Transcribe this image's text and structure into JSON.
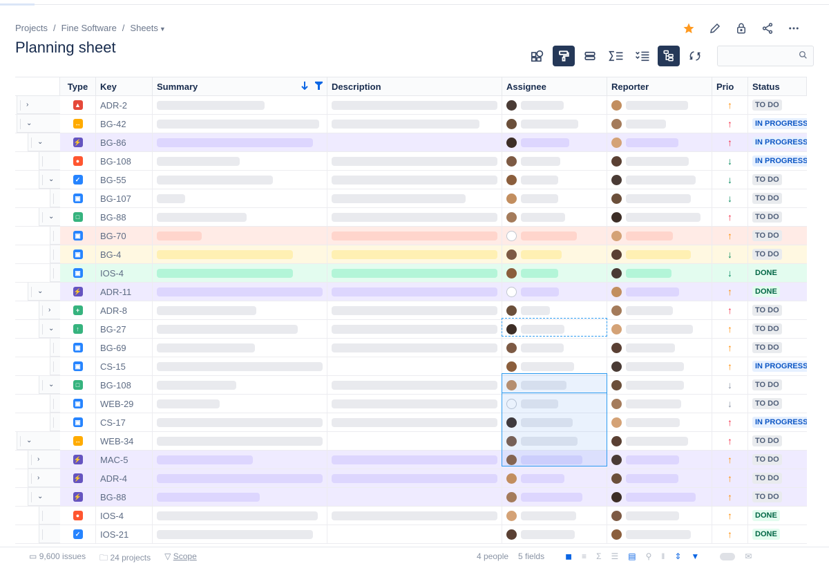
{
  "breadcrumb": [
    "Projects",
    "Fine Software",
    "Sheets"
  ],
  "page_title": "Planning sheet",
  "top_actions": [
    "star-icon",
    "edit-icon",
    "lock-icon",
    "share-icon",
    "more-icon"
  ],
  "toolbar": [
    {
      "icon": "dashboard-icon",
      "active": false
    },
    {
      "icon": "paint-roller-icon",
      "active": true
    },
    {
      "icon": "rows-icon",
      "active": false
    },
    {
      "icon": "sum-icon",
      "active": false
    },
    {
      "icon": "checklist-icon",
      "active": false
    },
    {
      "icon": "hierarchy-icon",
      "active": true
    },
    {
      "icon": "refresh-icon",
      "active": false
    }
  ],
  "search": {
    "placeholder": ""
  },
  "columns": [
    "",
    "Type",
    "Key",
    "Summary",
    "Description",
    "Assignee",
    "Reporter",
    "Prio",
    "Status"
  ],
  "colors": {
    "row_purple": "#efebff",
    "bar_purple": "#ddd6fe",
    "row_red": "#ffebe6",
    "bar_red": "#ffd5cc",
    "row_yellow": "#fff8e1",
    "bar_yellow": "#fff0b3",
    "row_green": "#e3fcef",
    "bar_green": "#b3f5d8",
    "prio_high": "#f42a45",
    "prio_medium": "#ff8b00",
    "prio_low": "#00875a",
    "prio_lowest": "#8993a4"
  },
  "rows": [
    {
      "level": 0,
      "toggle": "collapsed",
      "type": "bug",
      "key": "ADR-2",
      "summary": 0.65,
      "desc": 1.0,
      "assignee": "a1",
      "a_bar": 0.62,
      "reporter": "a2",
      "r_bar": 0.75,
      "prio": "medium",
      "status": "TO DO",
      "tint": ""
    },
    {
      "level": 0,
      "toggle": "expanded",
      "type": "epic-orange",
      "key": "BG-42",
      "summary": 0.98,
      "desc": 0.89,
      "assignee": "a3",
      "a_bar": 0.83,
      "reporter": "a4",
      "r_bar": 0.48,
      "prio": "high",
      "status": "IN PROGRESS",
      "tint": ""
    },
    {
      "level": 1,
      "toggle": "expanded",
      "type": "epic",
      "key": "BG-86",
      "summary": 0.94,
      "desc": 0,
      "assignee": "a5",
      "a_bar": 0.7,
      "reporter": "a6",
      "r_bar": 0.63,
      "prio": "high",
      "status": "IN PROGRESS",
      "tint": "purple"
    },
    {
      "level": 2,
      "toggle": "none",
      "type": "incident",
      "key": "BG-108",
      "summary": 0.5,
      "desc": 1.0,
      "assignee": "a7",
      "a_bar": 0.57,
      "reporter": "a8",
      "r_bar": 0.76,
      "prio": "low",
      "status": "IN PROGRESS",
      "tint": ""
    },
    {
      "level": 2,
      "toggle": "expanded",
      "type": "task",
      "key": "BG-55",
      "summary": 0.7,
      "desc": 1.0,
      "assignee": "a9",
      "a_bar": 0.54,
      "reporter": "a10",
      "r_bar": 0.84,
      "prio": "low",
      "status": "TO DO",
      "tint": ""
    },
    {
      "level": 3,
      "toggle": "none",
      "type": "subtask",
      "key": "BG-107",
      "summary": 0.17,
      "desc": 0.81,
      "assignee": "a11",
      "a_bar": 0.54,
      "reporter": "a12",
      "r_bar": 0.78,
      "prio": "low",
      "status": "TO DO",
      "tint": ""
    },
    {
      "level": 2,
      "toggle": "expanded",
      "type": "story",
      "key": "BG-88",
      "summary": 0.54,
      "desc": 1.0,
      "assignee": "a13",
      "a_bar": 0.64,
      "reporter": "a14",
      "r_bar": 0.9,
      "prio": "high",
      "status": "TO DO",
      "tint": ""
    },
    {
      "level": 3,
      "toggle": "none",
      "type": "subtask",
      "key": "BG-70",
      "summary": 0.27,
      "desc": 1.0,
      "assignee": "empty",
      "a_bar": 0.81,
      "reporter": "a15",
      "r_bar": 0.57,
      "prio": "medium",
      "status": "TO DO",
      "tint": "red"
    },
    {
      "level": 3,
      "toggle": "none",
      "type": "subtask",
      "key": "BG-4",
      "summary": 0.82,
      "desc": 1.0,
      "assignee": "a16",
      "a_bar": 0.59,
      "reporter": "a17",
      "r_bar": 0.78,
      "prio": "low",
      "status": "TO DO",
      "tint": "yellow"
    },
    {
      "level": 3,
      "toggle": "none",
      "type": "subtask",
      "key": "IOS-4",
      "summary": 0.82,
      "desc": 1.0,
      "assignee": "a18",
      "a_bar": 0.54,
      "reporter": "a19",
      "r_bar": 0.55,
      "prio": "low",
      "status": "DONE",
      "tint": "green"
    },
    {
      "level": 1,
      "toggle": "expanded",
      "type": "epic",
      "key": "ADR-11",
      "summary": 1.0,
      "desc": 1.0,
      "assignee": "empty",
      "a_bar": 0.55,
      "reporter": "a20",
      "r_bar": 0.64,
      "prio": "medium",
      "status": "DONE",
      "tint": "purple"
    },
    {
      "level": 2,
      "toggle": "collapsed",
      "type": "new-feature",
      "key": "ADR-8",
      "summary": 0.6,
      "desc": 1.0,
      "assignee": "a21",
      "a_bar": 0.42,
      "reporter": "a22",
      "r_bar": 0.57,
      "prio": "high",
      "status": "TO DO",
      "tint": ""
    },
    {
      "level": 2,
      "toggle": "expanded",
      "type": "improvement",
      "key": "BG-27",
      "summary": 0.85,
      "desc": 1.0,
      "assignee": "a23",
      "a_bar": 0.63,
      "reporter": "a24",
      "r_bar": 0.81,
      "prio": "medium",
      "status": "TO DO",
      "tint": ""
    },
    {
      "level": 3,
      "toggle": "none",
      "type": "subtask",
      "key": "BG-69",
      "summary": 0.59,
      "desc": 1.0,
      "assignee": "a25",
      "a_bar": 0.62,
      "reporter": "a26",
      "r_bar": 0.59,
      "prio": "medium",
      "status": "TO DO",
      "tint": ""
    },
    {
      "level": 3,
      "toggle": "none",
      "type": "subtask",
      "key": "CS-15",
      "summary": 1.0,
      "desc": 0,
      "assignee": "a27",
      "a_bar": 0.77,
      "reporter": "a28",
      "r_bar": 0.7,
      "prio": "medium",
      "status": "IN PROGRESS",
      "tint": ""
    },
    {
      "level": 2,
      "toggle": "expanded",
      "type": "story",
      "key": "BG-108",
      "summary": 0.48,
      "desc": 1.0,
      "assignee": "a29",
      "a_bar": 0.66,
      "reporter": "a30",
      "r_bar": 0.7,
      "prio": "lowest",
      "status": "TO DO",
      "tint": ""
    },
    {
      "level": 3,
      "toggle": "none",
      "type": "subtask",
      "key": "WEB-29",
      "summary": 0.38,
      "desc": 1.0,
      "assignee": "empty",
      "a_bar": 0.54,
      "reporter": "a31",
      "r_bar": 0.67,
      "prio": "lowest",
      "status": "TO DO",
      "tint": ""
    },
    {
      "level": 3,
      "toggle": "none",
      "type": "subtask",
      "key": "CS-17",
      "summary": 1.0,
      "desc": 1.0,
      "assignee": "a32",
      "a_bar": 0.75,
      "reporter": "a33",
      "r_bar": 0.65,
      "prio": "high",
      "status": "IN PROGRESS",
      "tint": ""
    },
    {
      "level": 0,
      "toggle": "expanded",
      "type": "epic-orange",
      "key": "WEB-34",
      "summary": 1.0,
      "desc": 0,
      "assignee": "a34",
      "a_bar": 0.82,
      "reporter": "a35",
      "r_bar": 0.75,
      "prio": "high",
      "status": "TO DO",
      "tint": ""
    },
    {
      "level": 1,
      "toggle": "collapsed",
      "type": "epic",
      "key": "MAC-5",
      "summary": 0.58,
      "desc": 1.0,
      "assignee": "a36",
      "a_bar": 0.89,
      "reporter": "a37",
      "r_bar": 0.64,
      "prio": "medium",
      "status": "TO DO",
      "tint": "purple"
    },
    {
      "level": 1,
      "toggle": "collapsed",
      "type": "epic",
      "key": "ADR-4",
      "summary": 1.0,
      "desc": 1.0,
      "assignee": "a38",
      "a_bar": 0.63,
      "reporter": "a39",
      "r_bar": 0.63,
      "prio": "medium",
      "status": "TO DO",
      "tint": "purple"
    },
    {
      "level": 1,
      "toggle": "expanded",
      "type": "epic",
      "key": "BG-88",
      "summary": 0.62,
      "desc": 0,
      "assignee": "a40",
      "a_bar": 0.89,
      "reporter": "a41",
      "r_bar": 0.84,
      "prio": "medium",
      "status": "TO DO",
      "tint": "purple"
    },
    {
      "level": 2,
      "toggle": "none",
      "type": "incident",
      "key": "IOS-4",
      "summary": 0.97,
      "desc": 1.0,
      "assignee": "a42",
      "a_bar": 0.8,
      "reporter": "a43",
      "r_bar": 0.64,
      "prio": "medium",
      "status": "DONE",
      "tint": ""
    },
    {
      "level": 2,
      "toggle": "none",
      "type": "task",
      "key": "IOS-21",
      "summary": 0.94,
      "desc": 0,
      "assignee": "a44",
      "a_bar": 0.78,
      "reporter": "a45",
      "r_bar": 0.78,
      "prio": "medium",
      "status": "DONE",
      "tint": ""
    }
  ],
  "footer": {
    "issues": "9,600 issues",
    "projects": "24 projects",
    "scope": "Scope",
    "people": "4 people",
    "fields": "5 fields"
  }
}
